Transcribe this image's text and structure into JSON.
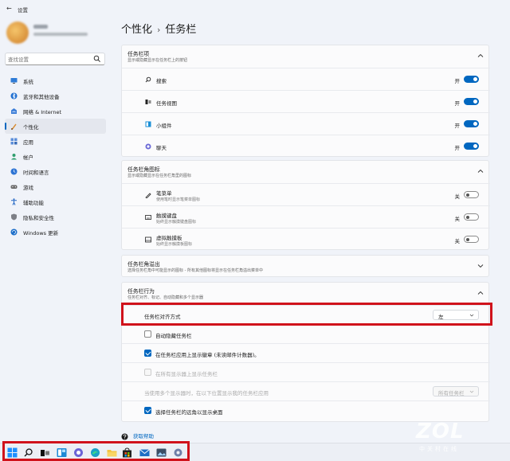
{
  "window": {
    "title": "设置",
    "back_icon": "back-arrow-icon"
  },
  "search": {
    "placeholder": "查找设置"
  },
  "sidebar": {
    "items": [
      {
        "label": "系统",
        "icon": "system-icon",
        "active": false
      },
      {
        "label": "蓝牙和其他设备",
        "icon": "bluetooth-icon",
        "active": false
      },
      {
        "label": "网络 & Internet",
        "icon": "network-icon",
        "active": false
      },
      {
        "label": "个性化",
        "icon": "personalization-icon",
        "active": true
      },
      {
        "label": "应用",
        "icon": "apps-icon",
        "active": false
      },
      {
        "label": "帐户",
        "icon": "account-icon",
        "active": false
      },
      {
        "label": "时间和语言",
        "icon": "time-language-icon",
        "active": false
      },
      {
        "label": "游戏",
        "icon": "gaming-icon",
        "active": false
      },
      {
        "label": "辅助功能",
        "icon": "accessibility-icon",
        "active": false
      },
      {
        "label": "隐私和安全性",
        "icon": "privacy-shield-icon",
        "active": false
      },
      {
        "label": "Windows 更新",
        "icon": "windows-update-icon",
        "active": false
      }
    ]
  },
  "breadcrumb": {
    "parent": "个性化",
    "sep": "›",
    "current": "任务栏"
  },
  "taskbar_items": {
    "title": "任务栏项",
    "subtitle": "显示或隐藏显示在任务栏上的按钮",
    "rows": [
      {
        "label": "搜索",
        "state": "开",
        "icon": "search-icon"
      },
      {
        "label": "任务视图",
        "state": "开",
        "icon": "task-view-icon"
      },
      {
        "label": "小组件",
        "state": "开",
        "icon": "widgets-icon"
      },
      {
        "label": "聊天",
        "state": "开",
        "icon": "chat-icon"
      }
    ]
  },
  "corner_icons": {
    "title": "任务栏角图标",
    "subtitle": "显示或隐藏显示在任务栏角里的图标",
    "rows": [
      {
        "label": "笔菜单",
        "sub": "使用笔时显示笔菜单图标",
        "state": "关",
        "icon": "pen-icon"
      },
      {
        "label": "触摸键盘",
        "sub": "始终显示触摸键盘图标",
        "state": "关",
        "icon": "keyboard-icon"
      },
      {
        "label": "虚拟触摸板",
        "sub": "始终显示触摸板图标",
        "state": "关",
        "icon": "touchpad-icon"
      }
    ]
  },
  "corner_overflow": {
    "title": "任务栏角溢出",
    "subtitle": "选择任务栏角中可能显示的图标 - 所有其他图标将显示在任务栏角溢出菜单中"
  },
  "behaviors": {
    "title": "任务栏行为",
    "subtitle": "任务栏对齐、标记、自动隐藏和多个显示器",
    "alignment_label": "任务栏对齐方式",
    "alignment_value": "左",
    "options": [
      {
        "label": "自动隐藏任务栏",
        "checked": false,
        "disabled": false
      },
      {
        "label": "在任务栏应用上显示徽章 (未读邮件计数器)。",
        "checked": true,
        "disabled": false
      },
      {
        "label": "在所有显示器上显示任务栏",
        "checked": false,
        "disabled": true
      }
    ],
    "multi_label": "当使用多个显示器时，在以下位置显示我的任务栏应用",
    "multi_value": "所有任务栏",
    "desktop_corner": {
      "label": "选择任务栏的远角以显示桌面",
      "checked": true
    }
  },
  "help": {
    "label": "获取帮助"
  },
  "taskbar": {
    "icons": [
      "start-icon",
      "search-icon",
      "task-view-icon",
      "widgets-icon",
      "chat-icon",
      "edge-icon",
      "file-explorer-icon",
      "store-icon",
      "mail-icon",
      "photos-icon",
      "settings-icon"
    ]
  },
  "watermark": {
    "big": "ZOL",
    "small": "中关村在线"
  },
  "colors": {
    "accent": "#0067c0",
    "highlight": "#d0121b"
  }
}
